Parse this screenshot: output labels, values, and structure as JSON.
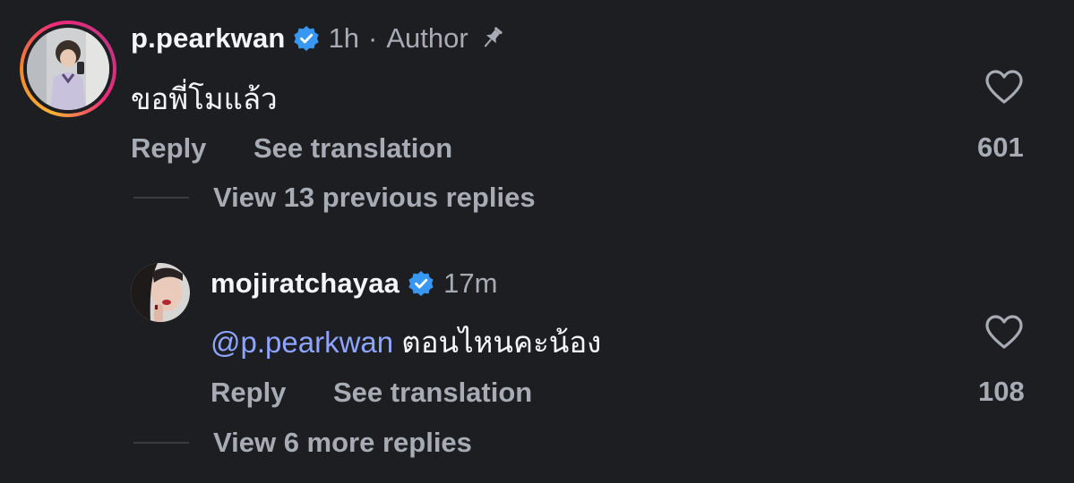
{
  "comment": {
    "username": "p.pearkwan",
    "time": "1h",
    "separator": "·",
    "author_label": "Author",
    "text": "ขอพี่โมแล้ว",
    "reply_label": "Reply",
    "translate_label": "See translation",
    "like_count": "601",
    "view_replies": "View 13 previous replies",
    "icons": [
      "verified-badge-icon",
      "pin-icon",
      "heart-icon"
    ]
  },
  "reply": {
    "username": "mojiratchayaa",
    "time": "17m",
    "mention": "@p.pearkwan",
    "text": " ตอนไหนคะน้อง",
    "reply_label": "Reply",
    "translate_label": "See translation",
    "like_count": "108",
    "icons": [
      "verified-badge-icon",
      "heart-icon"
    ]
  },
  "more_replies": "View 6 more replies",
  "colors": {
    "background": "#1d1e22",
    "primary_text": "#f5f5f7",
    "secondary_text": "#a7abb4",
    "mention": "#8ea5ff",
    "verified": "#3897f0"
  }
}
